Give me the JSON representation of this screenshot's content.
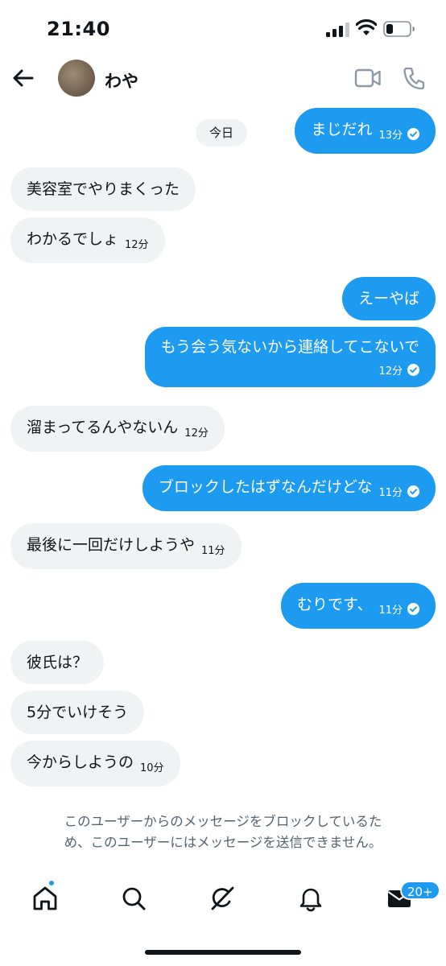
{
  "status_bar": {
    "time": "21:40"
  },
  "header": {
    "contact_name": "わや"
  },
  "day_label": "今日",
  "messages": [
    {
      "dir": "out",
      "text": "まじだれ",
      "time": "13分",
      "read": true
    },
    {
      "dir": "in",
      "text": "美容室でやりまくった"
    },
    {
      "dir": "in",
      "text": "わかるでしょ",
      "time": "12分"
    },
    {
      "dir": "out",
      "text": "えーやば"
    },
    {
      "dir": "out",
      "text": "もう会う気ないから連絡してこないで",
      "time": "12分",
      "read": true
    },
    {
      "dir": "in",
      "text": "溜まってるんやないん",
      "time": "12分"
    },
    {
      "dir": "out",
      "text": "ブロックしたはずなんだけどな",
      "time": "11分",
      "read": true
    },
    {
      "dir": "in",
      "text": "最後に一回だけしようや",
      "time": "11分"
    },
    {
      "dir": "out",
      "text": "むりです、",
      "time": "11分",
      "read": true
    },
    {
      "dir": "in",
      "text": "彼氏は？"
    },
    {
      "dir": "in",
      "text": "5分でいけそう"
    },
    {
      "dir": "in",
      "text": "今からしようの",
      "time": "10分"
    }
  ],
  "blocked_notice": {
    "line1": "このユーザーからのメッセージをブロックしているた",
    "line2": "め、このユーザーにはメッセージを送信できません。"
  },
  "tabbar": {
    "items": [
      "home",
      "search",
      "grok",
      "notifications",
      "messages"
    ],
    "messages_badge": "20+"
  },
  "colors": {
    "accent": "#1d9bf0",
    "incoming_bubble": "#eff3f4",
    "muted_text": "#536471"
  },
  "icons": [
    "back-arrow-icon",
    "video-camera-icon",
    "phone-icon",
    "home-icon",
    "search-icon",
    "grok-icon",
    "bell-icon",
    "mail-icon",
    "read-check-icon"
  ]
}
